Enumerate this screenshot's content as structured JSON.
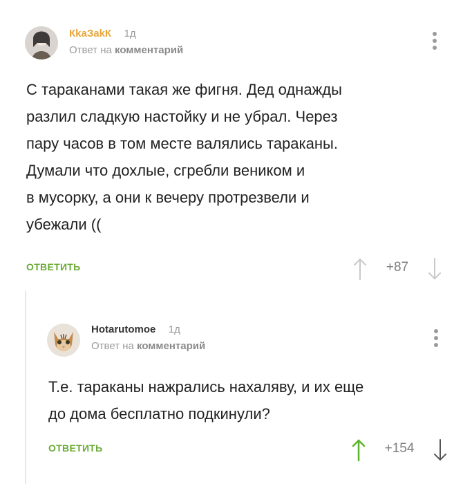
{
  "comments": [
    {
      "author": "КkаЗаkК",
      "time": "1д",
      "reply_prefix": "Ответ на",
      "reply_target": "комментарий",
      "text_lines": [
        "С тараканами такая же фигня. Дед однажды",
        "разлил сладкую настойку и не убрал. Через",
        "пару часов в том месте валялись тараканы.",
        "Думали что дохлые, сгребли веником и",
        "в мусорку, а они к вечеру протрезвели и",
        "убежали (("
      ],
      "reply_button": "ОТВЕТИТЬ",
      "rating": "+87",
      "upvote_active": false,
      "colors": {
        "author": "#e8a73a",
        "arrow": "#c8c8c8"
      }
    },
    {
      "author": "Hotarutomoe",
      "time": "1д",
      "reply_prefix": "Ответ на",
      "reply_target": "комментарий",
      "text_lines": [
        "Т.е. тараканы нажрались нахаляву, и их еще",
        "до дома бесплатно подкинули?"
      ],
      "reply_button": "ОТВЕТИТЬ",
      "rating": "+154",
      "upvote_active": true,
      "colors": {
        "author": "#333333",
        "upvote": "#5ab32a",
        "arrow": "#555555"
      }
    }
  ],
  "icons": {
    "menu": "more-vertical-icon",
    "upvote": "arrow-up-icon",
    "downvote": "arrow-down-icon"
  },
  "accent": "#6aaa35"
}
